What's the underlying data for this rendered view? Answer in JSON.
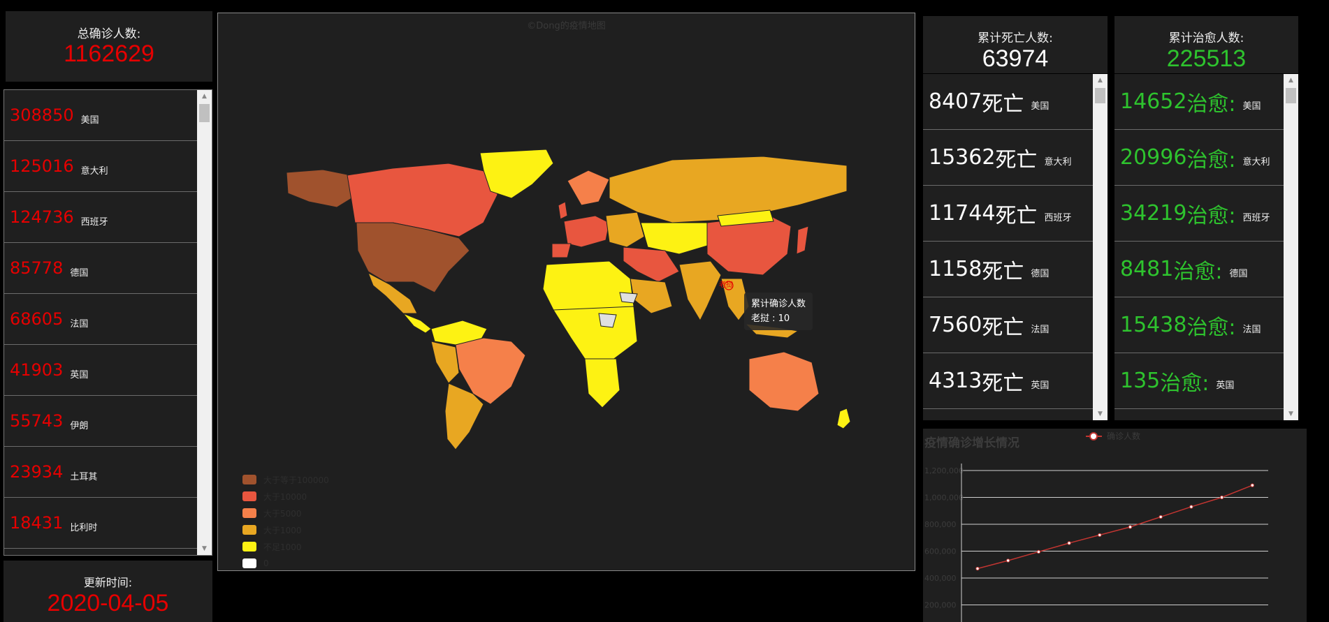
{
  "total": {
    "label": "总确诊人数:",
    "value": "1162629"
  },
  "confirmed_list": [
    {
      "value": "308850",
      "country": "美国"
    },
    {
      "value": "125016",
      "country": "意大利"
    },
    {
      "value": "124736",
      "country": "西班牙"
    },
    {
      "value": "85778",
      "country": "德国"
    },
    {
      "value": "68605",
      "country": "法国"
    },
    {
      "value": "41903",
      "country": "英国"
    },
    {
      "value": "55743",
      "country": "伊朗"
    },
    {
      "value": "23934",
      "country": "土耳其"
    },
    {
      "value": "18431",
      "country": "比利时"
    }
  ],
  "update": {
    "label": "更新时间:",
    "value": "2020-04-05"
  },
  "map": {
    "title": "©Dong的疫情地图",
    "tooltip_title": "累计确诊人数",
    "tooltip_value": "老挝 : 10",
    "marker_label": "老挝",
    "legend": [
      {
        "label": "大于等于100000",
        "color": "#a0522d"
      },
      {
        "label": "大于10000",
        "color": "#e8563f"
      },
      {
        "label": "大于5000",
        "color": "#f5804a"
      },
      {
        "label": "大于1000",
        "color": "#e8a722"
      },
      {
        "label": "不足1000",
        "color": "#fdf213"
      },
      {
        "label": "0",
        "color": "#ffffff"
      }
    ]
  },
  "deaths": {
    "label": "累计死亡人数:",
    "value": "63974",
    "suffix": "死亡"
  },
  "deaths_list": [
    {
      "value": "8407",
      "country": "美国"
    },
    {
      "value": "15362",
      "country": "意大利"
    },
    {
      "value": "11744",
      "country": "西班牙"
    },
    {
      "value": "1158",
      "country": "德国"
    },
    {
      "value": "7560",
      "country": "法国"
    },
    {
      "value": "4313",
      "country": "英国"
    }
  ],
  "recovered": {
    "label": "累计治愈人数:",
    "value": "225513",
    "suffix": "治愈:"
  },
  "recovered_list": [
    {
      "value": "14652",
      "country": "美国"
    },
    {
      "value": "20996",
      "country": "意大利"
    },
    {
      "value": "34219",
      "country": "西班牙"
    },
    {
      "value": "8481",
      "country": "德国"
    },
    {
      "value": "15438",
      "country": "法国"
    },
    {
      "value": "135",
      "country": "英国"
    }
  ],
  "colors": {
    "confirmed": "#e60000",
    "recovered": "#2ec32e",
    "death": "#ffffff",
    "line": "#c23531"
  },
  "growth_chart": {
    "title": "疫情确诊增长情况",
    "legend": "确诊人数"
  },
  "chart_data": {
    "type": "line",
    "title": "疫情确诊增长情况",
    "series": [
      {
        "name": "确诊人数",
        "values": [
          470000,
          530000,
          595000,
          660000,
          720000,
          780000,
          855000,
          930000,
          1000000,
          1090000
        ]
      }
    ],
    "y_ticks": [
      "1,200,000",
      "1,000,000",
      "800,000",
      "600,000",
      "400,000",
      "200,000"
    ],
    "ylim": [
      0,
      1200000
    ],
    "grid": true,
    "legend_position": "top"
  }
}
